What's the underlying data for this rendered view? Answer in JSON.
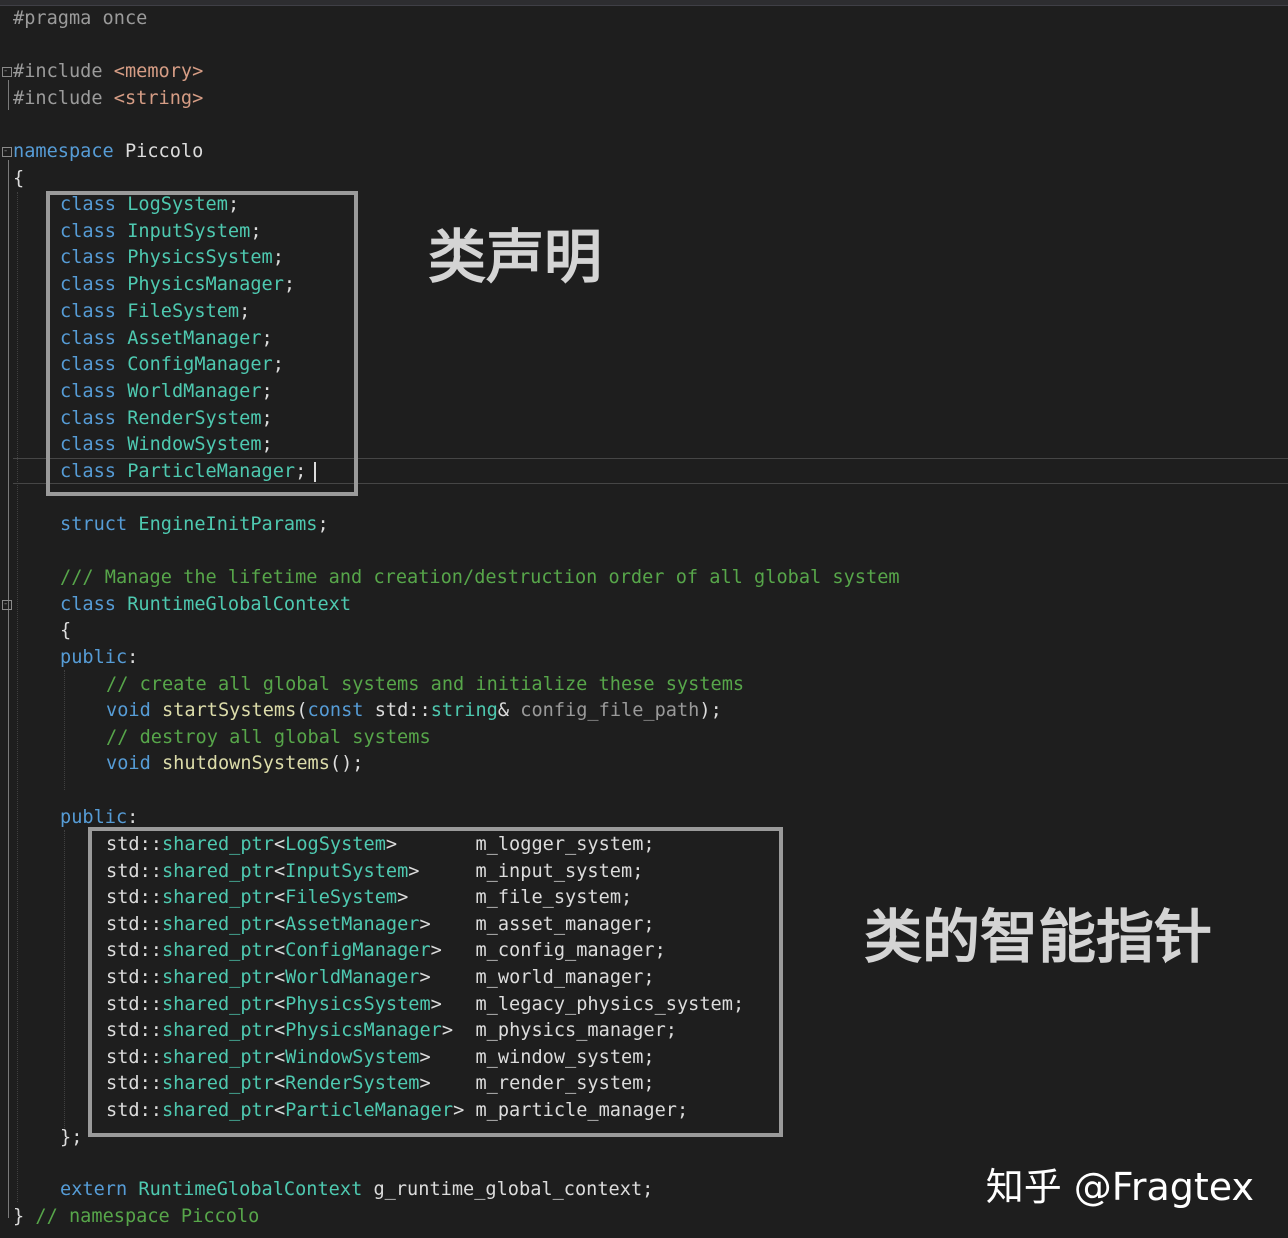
{
  "editor": {
    "lines": {
      "pragma": "#pragma once",
      "include_kw_1": "#include ",
      "include_hdr_1": "<memory>",
      "include_kw_2": "#include ",
      "include_hdr_2": "<string>",
      "ns_kw": "namespace",
      "ns_name": " Piccolo",
      "open_brace": "{",
      "class_kw": "class",
      "struct_kw": "struct",
      "struct_name": "EngineInitParams",
      "doc_comment": "/// Manage the lifetime and creation/destruction order of all global system",
      "rgc_name": "RuntimeGlobalContext",
      "class_open": "{",
      "public_kw": "public",
      "comment_create": "// create all global systems and initialize these systems",
      "void_kw": "void",
      "fn_start": "startSystems",
      "const_kw": "const",
      "std_ns": "std::",
      "string_ty": "string",
      "param_name": "config_file_path",
      "comment_destroy": "// destroy all global systems",
      "fn_shutdown": "shutdownSystems",
      "class_close": "};",
      "extern_kw": "extern",
      "global_var": "g_runtime_global_context",
      "ns_close": "}",
      "ns_close_comment": "// namespace Piccolo"
    },
    "forward_decls": [
      "LogSystem",
      "InputSystem",
      "PhysicsSystem",
      "PhysicsManager",
      "FileSystem",
      "AssetManager",
      "ConfigManager",
      "WorldManager",
      "RenderSystem",
      "WindowSystem",
      "ParticleManager"
    ],
    "members": [
      {
        "type": "LogSystem",
        "pad": "      ",
        "name": "m_logger_system"
      },
      {
        "type": "InputSystem",
        "pad": "    ",
        "name": "m_input_system"
      },
      {
        "type": "FileSystem",
        "pad": "     ",
        "name": "m_file_system"
      },
      {
        "type": "AssetManager",
        "pad": "   ",
        "name": "m_asset_manager"
      },
      {
        "type": "ConfigManager",
        "pad": "  ",
        "name": "m_config_manager"
      },
      {
        "type": "WorldManager",
        "pad": "   ",
        "name": "m_world_manager"
      },
      {
        "type": "PhysicsSystem",
        "pad": "  ",
        "name": "m_legacy_physics_system"
      },
      {
        "type": "PhysicsManager",
        "pad": " ",
        "name": "m_physics_manager"
      },
      {
        "type": "WindowSystem",
        "pad": "   ",
        "name": "m_window_system"
      },
      {
        "type": "RenderSystem",
        "pad": "   ",
        "name": "m_render_system"
      },
      {
        "type": "ParticleManager",
        "pad": "",
        "name": "m_particle_manager"
      }
    ],
    "shared_ptr": "shared_ptr"
  },
  "annotations": {
    "class_decl": "类声明",
    "smart_ptr": "类的智能指针"
  },
  "watermark": "知乎 @Fragtex",
  "colors": {
    "background": "#1e1e1e",
    "keyword": "#569cd6",
    "type": "#4ec9b0",
    "comment": "#57a64a",
    "function": "#dcdcaa",
    "annotation_box": "#9a9a9a"
  }
}
